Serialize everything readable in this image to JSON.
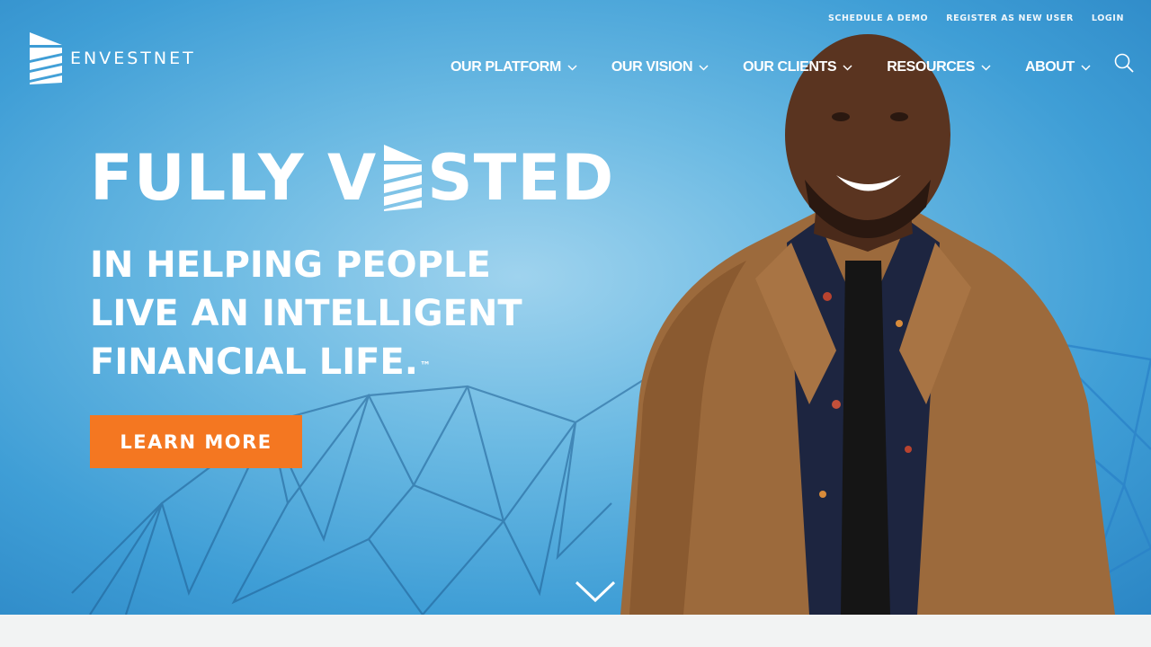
{
  "utility_nav": [
    {
      "label": "SCHEDULE A DEMO"
    },
    {
      "label": "REGISTER AS NEW USER"
    },
    {
      "label": "LOGIN"
    }
  ],
  "logo": {
    "text": "ENVESTNET"
  },
  "main_nav": [
    {
      "label": "OUR PLATFORM"
    },
    {
      "label": "OUR VISION"
    },
    {
      "label": "OUR CLIENTS"
    },
    {
      "label": "RESOURCES"
    },
    {
      "label": "ABOUT"
    }
  ],
  "hero": {
    "headline_part1": "FULLY V",
    "headline_part2": "STED",
    "tagline_lines": [
      "IN HELPING PEOPLE",
      "LIVE AN INTELLIGENT",
      "FINANCIAL LIFE."
    ],
    "trademark": "™",
    "cta_label": "LEARN MORE"
  },
  "colors": {
    "accent": "#f47721",
    "hero_blue": "#4fa8dc",
    "text": "#ffffff"
  },
  "icons": [
    "envestnet-logo-icon",
    "chevron-down-icon",
    "search-icon",
    "scroll-down-chevron-icon"
  ]
}
